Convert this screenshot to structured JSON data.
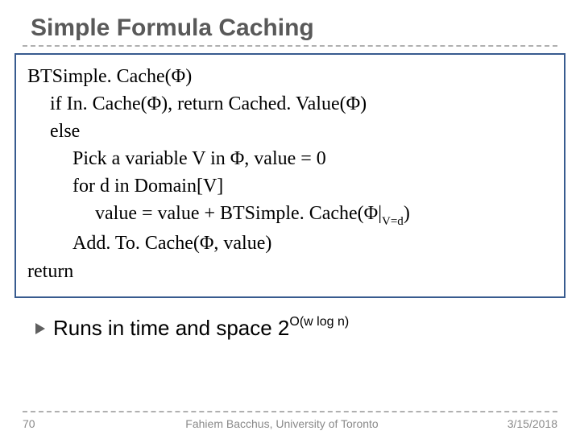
{
  "title": "Simple Formula Caching",
  "code": {
    "l1_a": "BTSimple. Cache(",
    "l1_b": ")",
    "l2_a": "if In. Cache(",
    "l2_b": "), return Cached. Value(",
    "l2_c": ")",
    "l3": "else",
    "l4_a": "Pick a variable V in ",
    "l4_b": ", value = 0",
    "l5": "for d in Domain[V]",
    "l6_a": "value = value + BTSimple. Cache(",
    "l6_b": "|",
    "l6_sub": "V=d",
    "l6_c": ")",
    "l7_a": "Add. To. Cache(",
    "l7_b": ", value)",
    "l8": "return",
    "phi": "Φ"
  },
  "bullet": {
    "text_a": "Runs in time and space 2",
    "sup": "O(w log n)"
  },
  "footer": {
    "pagenum": "70",
    "center": "Fahiem Bacchus, University of Toronto",
    "date": "3/15/2018"
  }
}
